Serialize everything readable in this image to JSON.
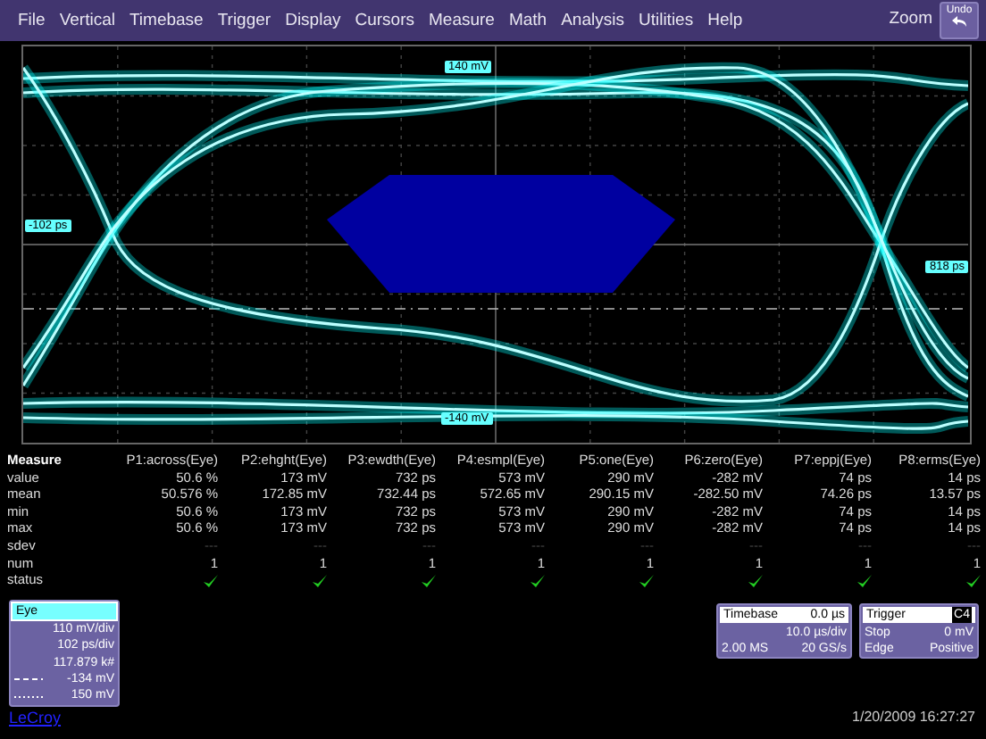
{
  "menu": {
    "items": [
      "File",
      "Vertical",
      "Timebase",
      "Trigger",
      "Display",
      "Cursors",
      "Measure",
      "Math",
      "Analysis",
      "Utilities",
      "Help"
    ],
    "zoom_label": "Zoom",
    "undo_label": "Undo"
  },
  "plot": {
    "labels": [
      {
        "text": "140 mV",
        "kind": "top"
      },
      {
        "text": "-102 ps",
        "kind": "left"
      },
      {
        "text": "818 ps",
        "kind": "right"
      },
      {
        "text": "-140 mV",
        "kind": "bottom"
      }
    ]
  },
  "measure": {
    "title": "Measure",
    "columns": [
      "P1:across(Eye)",
      "P2:ehght(Eye)",
      "P3:ewdth(Eye)",
      "P4:esmpl(Eye)",
      "P5:one(Eye)",
      "P6:zero(Eye)",
      "P7:eppj(Eye)",
      "P8:erms(Eye)"
    ],
    "rows": [
      {
        "label": "value",
        "kind": "text",
        "values": [
          "50.6 %",
          "173 mV",
          "732 ps",
          "573 mV",
          "290 mV",
          "-282 mV",
          "74 ps",
          "14 ps"
        ]
      },
      {
        "label": "mean",
        "kind": "text",
        "values": [
          "50.576 %",
          "172.85 mV",
          "732.44 ps",
          "572.65 mV",
          "290.15 mV",
          "-282.50 mV",
          "74.26 ps",
          "13.57 ps"
        ]
      },
      {
        "label": "min",
        "kind": "text",
        "values": [
          "50.6 %",
          "173 mV",
          "732 ps",
          "573 mV",
          "290 mV",
          "-282 mV",
          "74 ps",
          "14 ps"
        ]
      },
      {
        "label": "max",
        "kind": "text",
        "values": [
          "50.6 %",
          "173 mV",
          "732 ps",
          "573 mV",
          "290 mV",
          "-282 mV",
          "74 ps",
          "14 ps"
        ]
      },
      {
        "label": "sdev",
        "kind": "text",
        "values": [
          "---",
          "---",
          "---",
          "---",
          "---",
          "---",
          "---",
          "---"
        ]
      },
      {
        "label": "num",
        "kind": "text",
        "values": [
          "1",
          "1",
          "1",
          "1",
          "1",
          "1",
          "1",
          "1"
        ]
      },
      {
        "label": "status",
        "kind": "status",
        "ok": [
          true,
          true,
          true,
          true,
          true,
          true,
          true,
          true
        ]
      }
    ]
  },
  "eye_panel": {
    "title": "Eye",
    "lines": [
      {
        "text": "110 mV/div",
        "kind": "plain"
      },
      {
        "text": "102 ps/div",
        "kind": "plain"
      },
      {
        "text": "117.879 k#",
        "kind": "plain"
      },
      {
        "text": "-134 mV",
        "kind": "dashed"
      },
      {
        "text": "150 mV",
        "kind": "dotted"
      }
    ]
  },
  "timebase": {
    "title": "Timebase",
    "value": "0.0 µs",
    "rows": [
      [
        "",
        "10.0 µs/div"
      ],
      [
        "2.00 MS",
        "20 GS/s"
      ]
    ]
  },
  "trigger": {
    "title": "Trigger",
    "channel": "C4",
    "rows": [
      [
        "Stop",
        "0 mV"
      ],
      [
        "Edge",
        "Positive"
      ]
    ]
  },
  "footer": {
    "brand": "LeCroy",
    "datetime": "1/20/2009 16:27:27"
  }
}
